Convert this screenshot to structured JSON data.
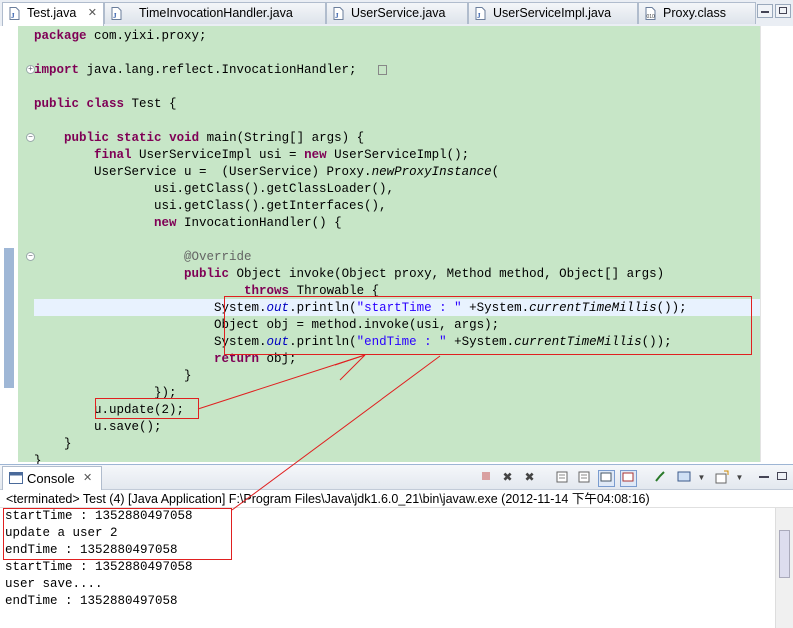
{
  "tabs": [
    {
      "label": "Test.java",
      "icon": "java-file-icon",
      "active": true,
      "close": "✕"
    },
    {
      "label": "TimeInvocationHandler.java",
      "icon": "java-file-icon"
    },
    {
      "label": "UserService.java",
      "icon": "java-file-icon"
    },
    {
      "label": "UserServiceImpl.java",
      "icon": "java-file-icon"
    },
    {
      "label": "Proxy.class",
      "icon": "class-file-icon"
    }
  ],
  "code": [
    {
      "parts": [
        {
          "t": "package",
          "c": "kw"
        },
        {
          "t": " com.yixi.proxy;"
        }
      ]
    },
    {
      "parts": [
        {
          "t": "import",
          "c": "kw"
        },
        {
          "t": " java.lang.reflect.InvocationHandler;"
        }
      ]
    },
    {
      "parts": [
        {
          "t": "public",
          "c": "kw"
        },
        {
          "t": " "
        },
        {
          "t": "class",
          "c": "kw"
        },
        {
          "t": " Test {"
        }
      ]
    },
    {
      "parts": [
        {
          "t": "    "
        },
        {
          "t": "public",
          "c": "kw"
        },
        {
          "t": " "
        },
        {
          "t": "static",
          "c": "kw"
        },
        {
          "t": " "
        },
        {
          "t": "void",
          "c": "kw"
        },
        {
          "t": " main(String[] args) {"
        }
      ]
    },
    {
      "parts": [
        {
          "t": "        "
        },
        {
          "t": "final",
          "c": "kw"
        },
        {
          "t": " UserServiceImpl usi = "
        },
        {
          "t": "new",
          "c": "kw"
        },
        {
          "t": " UserServiceImpl();"
        }
      ]
    },
    {
      "parts": [
        {
          "t": "        UserService u =  (UserService) Proxy."
        },
        {
          "t": "newProxyInstance",
          "c": "it"
        },
        {
          "t": "("
        }
      ]
    },
    {
      "parts": [
        {
          "t": "                usi.getClass().getClassLoader(),"
        }
      ]
    },
    {
      "parts": [
        {
          "t": "                usi.getClass().getInterfaces(),"
        }
      ]
    },
    {
      "parts": [
        {
          "t": "                "
        },
        {
          "t": "new",
          "c": "kw"
        },
        {
          "t": " InvocationHandler() {"
        }
      ]
    },
    {
      "parts": [
        {
          "t": "                    "
        },
        {
          "t": "@Override",
          "c": "ann"
        }
      ]
    },
    {
      "parts": [
        {
          "t": "                    "
        },
        {
          "t": "public",
          "c": "kw"
        },
        {
          "t": " Object invoke(Object proxy, Method method, Object[] args)"
        }
      ]
    },
    {
      "parts": [
        {
          "t": "                            "
        },
        {
          "t": "throws",
          "c": "kw"
        },
        {
          "t": " Throwable {"
        }
      ]
    },
    {
      "parts": [
        {
          "t": "                        System."
        },
        {
          "t": "out",
          "c": "fld"
        },
        {
          "t": ".println("
        },
        {
          "t": "\"startTime : \"",
          "c": "str"
        },
        {
          "t": " +System."
        },
        {
          "t": "currentTimeMillis",
          "c": "it"
        },
        {
          "t": "());"
        }
      ]
    },
    {
      "parts": [
        {
          "t": "                        Object obj = method.invoke(usi, args);"
        }
      ]
    },
    {
      "parts": [
        {
          "t": "                        System."
        },
        {
          "t": "out",
          "c": "fld"
        },
        {
          "t": ".println("
        },
        {
          "t": "\"endTime : \"",
          "c": "str"
        },
        {
          "t": " +System."
        },
        {
          "t": "currentTimeMillis",
          "c": "it"
        },
        {
          "t": "());"
        }
      ]
    },
    {
      "parts": [
        {
          "t": "                        "
        },
        {
          "t": "return",
          "c": "kw"
        },
        {
          "t": " obj;"
        }
      ]
    },
    {
      "parts": [
        {
          "t": "                    }"
        }
      ]
    },
    {
      "parts": [
        {
          "t": "                });"
        }
      ]
    },
    {
      "parts": [
        {
          "t": "        u.update(2);"
        }
      ]
    },
    {
      "parts": [
        {
          "t": "        u.save();"
        }
      ]
    },
    {
      "parts": [
        {
          "t": "    }"
        }
      ]
    },
    {
      "parts": [
        {
          "t": "}"
        }
      ]
    }
  ],
  "console": {
    "tab_label": "Console",
    "status": "<terminated> Test (4) [Java Application] F:\\Program Files\\Java\\jdk1.6.0_21\\bin\\javaw.exe (2012-11-14 下午04:08:16)",
    "output": [
      "startTime : 1352880497058",
      "update a user 2",
      "endTime : 1352880497058",
      "startTime : 1352880497058",
      "user save....",
      "endTime : 1352880497058"
    ]
  },
  "colors": {
    "editor_bg": "#c7e6c7",
    "keyword": "#7f0055",
    "string": "#2a00ff",
    "annotation": "#e02020"
  }
}
